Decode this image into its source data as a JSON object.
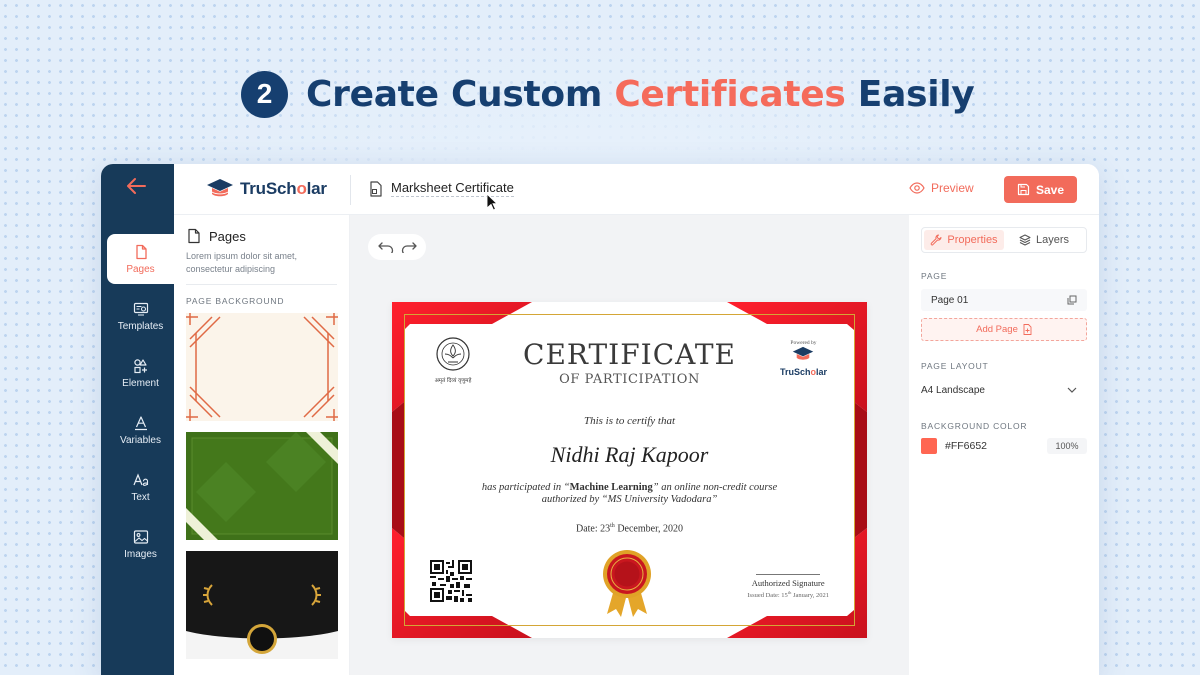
{
  "headline": {
    "step_number": "2",
    "text_before": "Create Custom ",
    "text_accent": "Certificates",
    "text_after": " Easily"
  },
  "colors": {
    "accent": "#f26b5b",
    "navy": "#163f70",
    "rail": "#173a59",
    "background_color_value": "#FF6652"
  },
  "app": {
    "logo": {
      "name_part1": "TruSch",
      "name_part2": "o",
      "name_part3": "lar"
    },
    "doc_title": "Marksheet Certificate",
    "preview_label": "Preview",
    "save_label": "Save"
  },
  "rail": {
    "items": [
      {
        "label": "Pages",
        "icon": "page-icon"
      },
      {
        "label": "Templates",
        "icon": "templates-icon"
      },
      {
        "label": "Element",
        "icon": "element-icon"
      },
      {
        "label": "Variables",
        "icon": "variables-icon"
      },
      {
        "label": "Text",
        "icon": "text-icon"
      },
      {
        "label": "Images",
        "icon": "images-icon"
      }
    ]
  },
  "left_panel": {
    "title": "Pages",
    "description": "Lorem ipsum dolor sit amet, consectetur adipiscing",
    "section_label": "PAGE BACKGROUND"
  },
  "certificate": {
    "title": "CERTIFICATE",
    "subtitle": "OF PARTICIPATION",
    "certify_line": "This is to certify that",
    "recipient": "Nidhi Raj Kapoor",
    "body_part1": "has participated in “",
    "course": "Machine Learning",
    "body_part2": "” an online non-credit course",
    "body_line2": "authorized by “MS University Vadodara”",
    "date_prefix": "Date: 23",
    "date_sup": "th",
    "date_suffix": " December, 2020",
    "powered_by": "Powered by",
    "powered_name_1": "TruSch",
    "powered_name_2": "o",
    "powered_name_3": "lar",
    "signature_label": "Authorized Signature",
    "issued_prefix": "Issued Date: 15",
    "issued_sup": "th",
    "issued_suffix": " January, 2021",
    "university_motto": "अमृतं दिव्यं वृणुमहे"
  },
  "right_panel": {
    "tab_properties": "Properties",
    "tab_layers": "Layers",
    "page_label": "PAGE",
    "page_item": "Page 01",
    "add_page_label": "Add Page",
    "layout_label": "PAGE LAYOUT",
    "layout_value": "A4 Landscape",
    "bgcolor_label": "BACKGROUND COLOR",
    "bgcolor_value": "#FF6652",
    "opacity_value": "100%"
  }
}
